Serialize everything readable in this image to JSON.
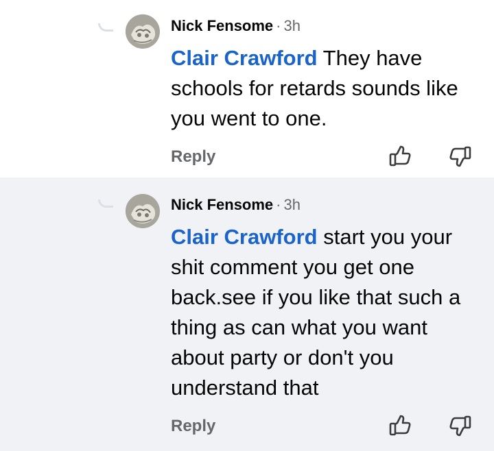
{
  "comments": [
    {
      "author": "Nick Fensome",
      "separator": "·",
      "time": "3h",
      "mention": "Clair Crawford",
      "text": " They have schools for retards sounds like you went to one.",
      "reply_label": "Reply",
      "like_icon": "thumbs-up-icon",
      "dislike_icon": "thumbs-down-icon"
    },
    {
      "author": "Nick Fensome",
      "separator": "·",
      "time": "3h",
      "mention": "Clair Crawford",
      "text": " start you your shit comment you get one back.see if you like that such a thing as can what you want about party or don't you understand that",
      "reply_label": "Reply",
      "like_icon": "thumbs-up-icon",
      "dislike_icon": "thumbs-down-icon"
    }
  ],
  "colors": {
    "mention": "#1a63c9",
    "secondary_text": "#65676b",
    "highlight_bg": "#f0f2f5",
    "thread_line": "#dcdfe3"
  }
}
